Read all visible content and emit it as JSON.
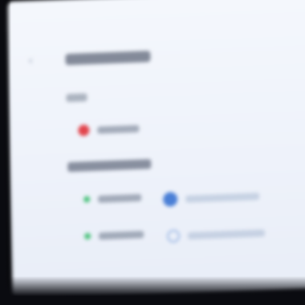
{
  "screen": {
    "header": {
      "back_icon": "chevron-left-icon"
    },
    "sections": [
      {
        "rows": [
          {
            "status_color": "#e2444c",
            "icon": "status-dot-icon"
          }
        ]
      },
      {
        "rows": [
          {
            "left": {
              "status_color": "#49c27a",
              "icon": "status-dot-icon"
            },
            "right": {
              "status_color": "#4a7fd6",
              "icon": "toggle-icon"
            }
          },
          {
            "left": {
              "status_color": "#49c27a",
              "icon": "status-dot-icon"
            },
            "right": {
              "status_color": "#9bb7e4",
              "icon": "radio-icon"
            }
          }
        ]
      }
    ]
  }
}
